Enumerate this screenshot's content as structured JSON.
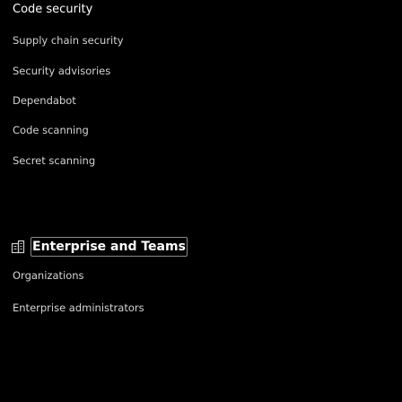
{
  "code_security": {
    "heading": "Code security",
    "items": [
      {
        "label": "Supply chain security"
      },
      {
        "label": "Security advisories"
      },
      {
        "label": "Dependabot"
      },
      {
        "label": "Code scanning"
      },
      {
        "label": "Secret scanning"
      }
    ]
  },
  "enterprise": {
    "heading": "Enterprise and Teams",
    "icon": "enterprise-building-icon",
    "items": [
      {
        "label": "Organizations"
      },
      {
        "label": "Enterprise administrators"
      }
    ]
  }
}
